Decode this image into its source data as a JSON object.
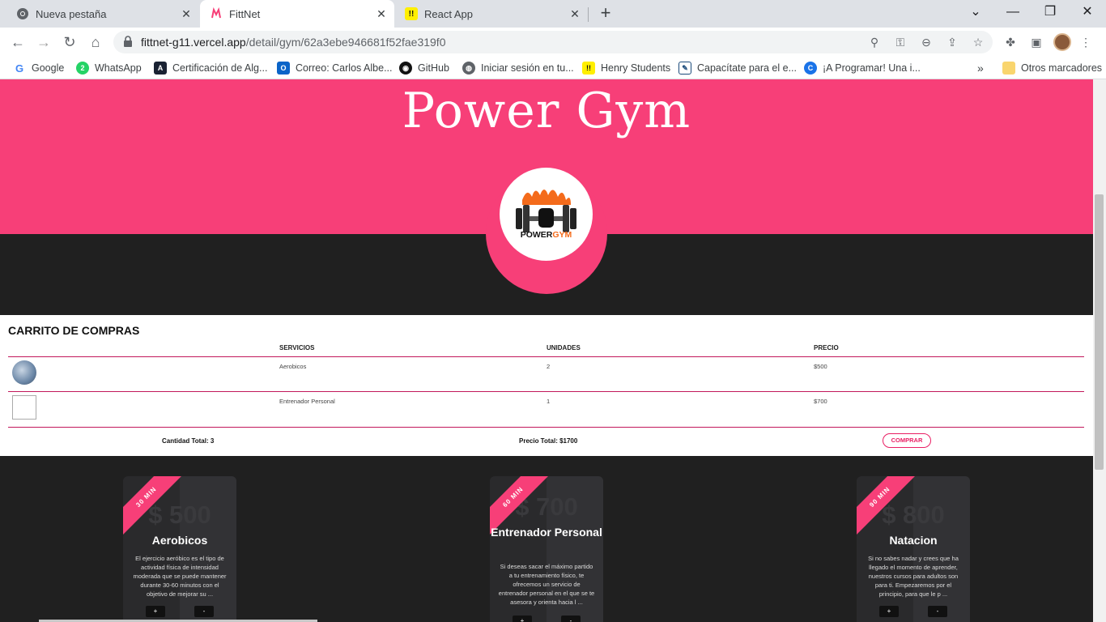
{
  "browser": {
    "tabs": [
      {
        "title": "Nueva pestaña",
        "icon": "chrome-icon",
        "active": false
      },
      {
        "title": "FittNet",
        "icon": "fittnet-icon",
        "active": true
      },
      {
        "title": "React App",
        "icon": "react-app-icon",
        "active": false
      }
    ],
    "url_domain": "fittnet-g11.vercel.app",
    "url_path": "/detail/gym/62a3ebe946681f52fae319f0",
    "bookmarks": [
      {
        "label": "Google",
        "icon": "google-icon"
      },
      {
        "label": "WhatsApp",
        "icon": "whatsapp-icon"
      },
      {
        "label": "Certificación de Alg...",
        "icon": "cert-icon"
      },
      {
        "label": "Correo: Carlos Albe...",
        "icon": "outlook-icon"
      },
      {
        "label": "GitHub",
        "icon": "github-icon"
      },
      {
        "label": "Iniciar sesión en tu...",
        "icon": "globe-icon"
      },
      {
        "label": "Henry Students",
        "icon": "henry-icon"
      },
      {
        "label": "Capacítate para el e...",
        "icon": "doc-icon"
      },
      {
        "label": "¡A Programar! Una i...",
        "icon": "c-icon"
      }
    ],
    "bookmarks_more": "»",
    "other_bookmarks": "Otros marcadores"
  },
  "hero": {
    "title": "Power Gym",
    "logo_text_a": "POWER",
    "logo_text_b": "GYM"
  },
  "cart": {
    "title": "CARRITO DE COMPRAS",
    "headers": {
      "services": "SERVICIOS",
      "units": "UNIDADES",
      "price": "PRECIO"
    },
    "rows": [
      {
        "service": "Aerobicos",
        "units": "2",
        "price": "$500"
      },
      {
        "service": "Entrenador Personal",
        "units": "1",
        "price": "$700"
      }
    ],
    "total_qty": "Cantidad Total: 3",
    "total_price": "Precio Total: $1700",
    "buy_label": "COMPRAR"
  },
  "cards": [
    {
      "duration": "30 MIN",
      "price": "$ 500",
      "name": "Aerobicos",
      "desc": "El ejercicio aeróbico es el tipo de actividad física de intensidad moderada que se puede mantener durante 30-60 minutos con el objetivo de mejorar su ...",
      "plus": "+",
      "minus": "-"
    },
    {
      "duration": "60 MIN",
      "price": "$ 700",
      "name": "Entrenador Personal",
      "desc": "Si deseas sacar el máximo partido a tu entrenamiento físico, te ofrecemos un servicio de entrenador personal en el que se te asesora y orienta hacia l ...",
      "plus": "+",
      "minus": "-"
    },
    {
      "duration": "90 MIN",
      "price": "$ 800",
      "name": "Natacion",
      "desc": "Si no sabes nadar y crees que ha llegado el momento de aprender, nuestros cursos para adultos son para ti. Empezaremos por el principio, para que le p ...",
      "plus": "+",
      "minus": "-"
    }
  ],
  "colors": {
    "brand_pink": "#f73f78",
    "dark_bg": "#202020"
  }
}
